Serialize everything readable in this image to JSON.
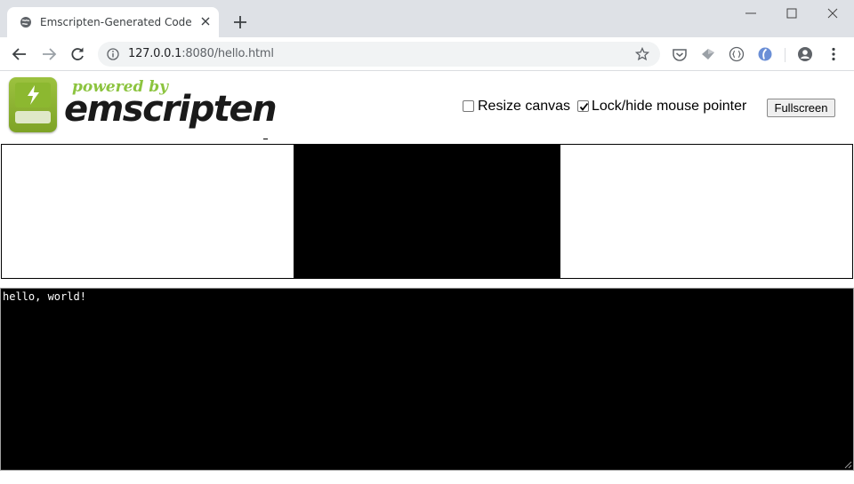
{
  "browser": {
    "tab_title": "Emscripten-Generated Code",
    "url_host": "127.0.0.1",
    "url_rest": ":8080/hello.html",
    "icons": {
      "favicon": "globe-icon",
      "back": "back-arrow-icon",
      "forward": "forward-arrow-icon",
      "reload": "reload-icon",
      "info": "info-icon",
      "bookmark": "star-icon",
      "extensions": [
        "pocket-icon",
        "extension-gray-icon",
        "extension-braces-icon",
        "extension-blue-icon"
      ],
      "profile": "account-icon",
      "menu": "kebab-menu-icon"
    }
  },
  "header": {
    "logo_powered": "powered by",
    "logo_word": "emscripten",
    "resize_label": "Resize canvas",
    "resize_checked": false,
    "lock_label": "Lock/hide mouse pointer",
    "lock_checked": true,
    "fullscreen_label": "Fullscreen"
  },
  "output": {
    "text": "hello, world!"
  },
  "colors": {
    "tabstrip": "#dee1e6",
    "logo_green": "#8cc43f",
    "canvas": "#000000",
    "output_bg": "#000000",
    "output_text": "#ffffff"
  }
}
